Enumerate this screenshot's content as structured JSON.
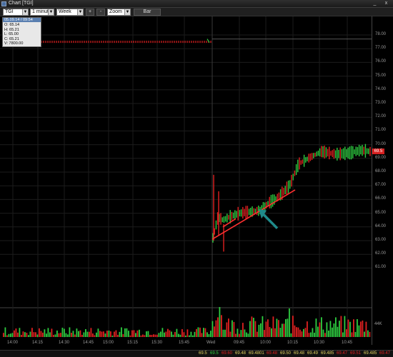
{
  "window": {
    "title": "Chart [TGI]",
    "minimize": "_",
    "close": "x"
  },
  "toolbar": {
    "symbol": "TGI",
    "interval": "1 minute",
    "range": "Week",
    "zoom_in": "+",
    "zoom_out": "-",
    "zoom": "Zoom",
    "style_button": "Bar"
  },
  "ohlc_panel": {
    "header": "05.09.14 / 09:54",
    "open": "O: 65.14",
    "high": "H: 65.21",
    "low": "L: 65.00",
    "close": "C: 65.21",
    "volume": "V: 7800.00"
  },
  "price_axis": [
    "78.00",
    "77.00",
    "76.00",
    "75.00",
    "74.00",
    "73.00",
    "72.00",
    "71.00",
    "70.00",
    "69.00",
    "68.00",
    "67.00",
    "66.00",
    "65.00",
    "64.00",
    "63.00",
    "62.00",
    "61.00"
  ],
  "last_price_label": "69.5",
  "volume_axis_label": "44K",
  "time_axis": [
    "14:00",
    "14:15",
    "14:30",
    "14:45",
    "15:00",
    "15:15",
    "15:30",
    "15:45",
    "Wed",
    "09:45",
    "10:00",
    "10:15",
    "10:30",
    "10:45"
  ],
  "status_bar": [
    "69.5",
    "69.5",
    "69.60",
    "69.48",
    "69.4801",
    "69.48",
    "69.50",
    "69.48",
    "69.49",
    "69.485",
    "69.47",
    "69.51",
    "69.485",
    "69.47"
  ],
  "colors": {
    "up": "#2ecc40",
    "down": "#e02020",
    "trend_line": "#ff3030",
    "arrow": "#1f8a8a",
    "grid": "#1c1c1c"
  },
  "chart_data": {
    "type": "bar",
    "prior_session": {
      "price_level": 77.5
    },
    "annotations": [
      "red-up-trend-line",
      "teal-arrow-pointer"
    ],
    "ylim": [
      60.5,
      79.0
    ]
  }
}
